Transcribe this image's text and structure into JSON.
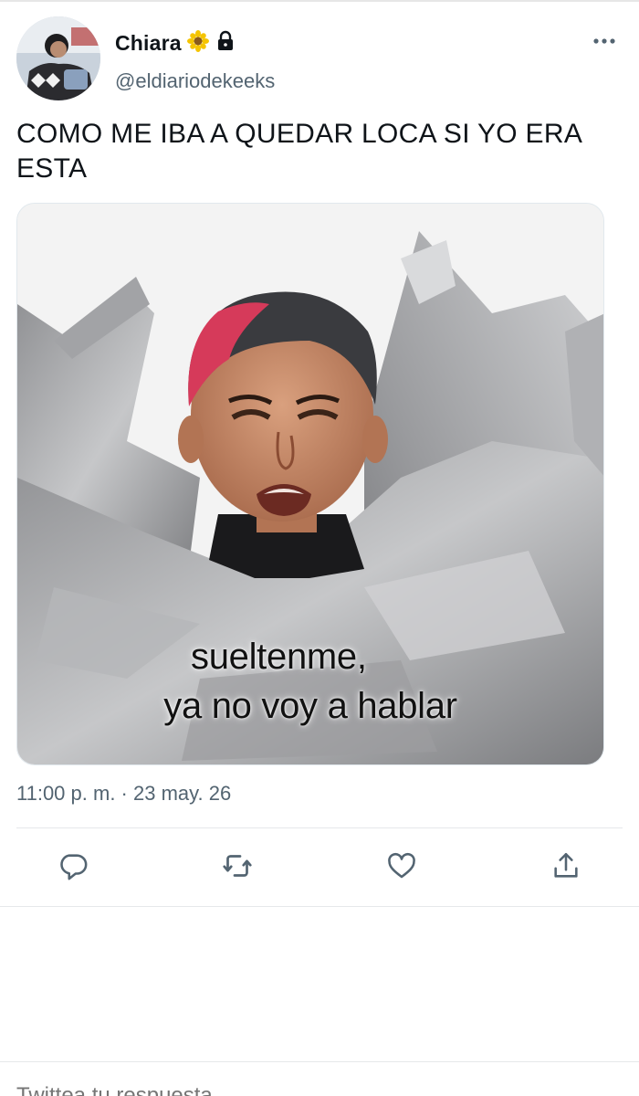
{
  "user": {
    "display_name": "Chiara",
    "handle": "@eldiariodekeeks",
    "badge_icon": "sunflower-emoji",
    "lock_icon": "lock-icon"
  },
  "tweet": {
    "text": "COMO ME IBA A QUEDAR LOCA SI YO ERA ESTA",
    "timestamp": "11:00 p. m. · 23 may. 26"
  },
  "media": {
    "caption_line1": "sueltenme,",
    "caption_line2": "ya no voy a hablar"
  },
  "actions": [
    {
      "name": "reply",
      "icon": "reply-icon"
    },
    {
      "name": "retweet",
      "icon": "retweet-icon"
    },
    {
      "name": "like",
      "icon": "heart-icon"
    },
    {
      "name": "share",
      "icon": "share-icon"
    }
  ],
  "reply_box": {
    "placeholder": "Twittea tu respuesta"
  },
  "colors": {
    "text": "#0f1419",
    "secondary": "#536471",
    "border": "#e6e8ea"
  }
}
